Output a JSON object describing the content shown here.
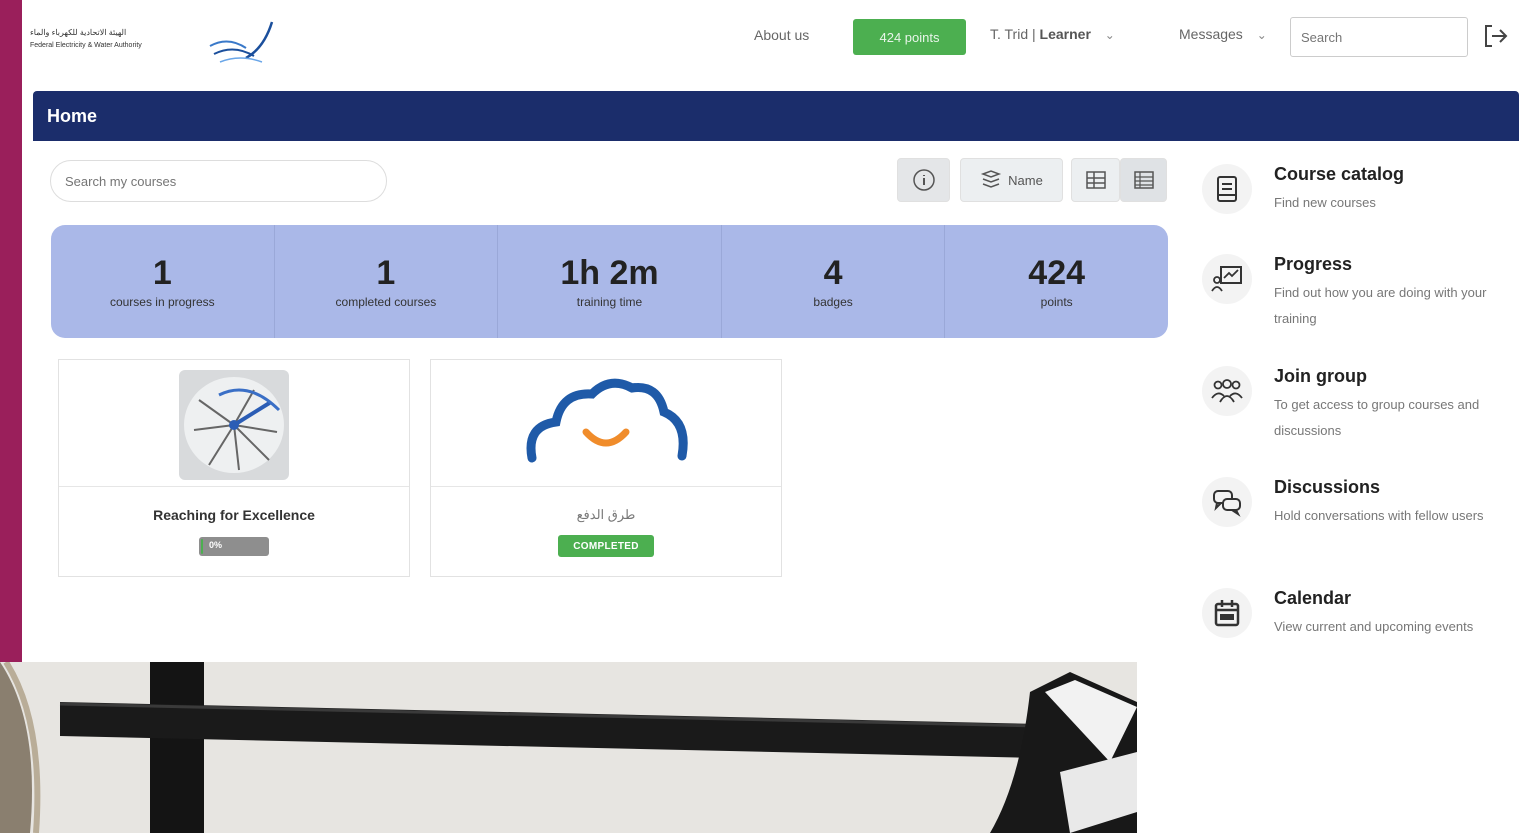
{
  "topbar": {
    "logo_ar": "الهيئة الاتحادية للكهرباء والماء",
    "logo_en": "Federal Electricity & Water Authority",
    "about": "About us",
    "points": "424 points",
    "user_name": "T. Trid |",
    "user_role": "Learner",
    "messages": "Messages",
    "search_placeholder": "Search"
  },
  "header": {
    "title": "Home"
  },
  "main": {
    "search_placeholder": "Search my courses",
    "sort_label": "Name",
    "stats": [
      {
        "value": "1",
        "label": "courses in progress"
      },
      {
        "value": "1",
        "label": "completed courses"
      },
      {
        "value": "1h 2m",
        "label": "training time"
      },
      {
        "value": "4",
        "label": "badges"
      },
      {
        "value": "424",
        "label": "points"
      }
    ],
    "courses": [
      {
        "title": "Reaching for Excellence",
        "progress_label": "0%",
        "progress": 0
      },
      {
        "title": "طرق الدفع",
        "status": "COMPLETED"
      }
    ]
  },
  "sidebar": {
    "items": [
      {
        "title": "Course catalog",
        "desc": "Find new courses",
        "icon": "catalog-icon"
      },
      {
        "title": "Progress",
        "desc": "Find out how you are doing with your training",
        "icon": "progress-icon"
      },
      {
        "title": "Join group",
        "desc": "To get access to group courses and discussions",
        "icon": "group-icon"
      },
      {
        "title": "Discussions",
        "desc": "Hold conversations with fellow users",
        "icon": "discussions-icon"
      },
      {
        "title": "Calendar",
        "desc": "View current and upcoming events",
        "icon": "calendar-icon"
      }
    ]
  },
  "colors": {
    "brand_band": "#1b2d6b",
    "points_green": "#4caf50",
    "stats_bg": "#aab8e8",
    "frame": "#9a1f5b"
  }
}
